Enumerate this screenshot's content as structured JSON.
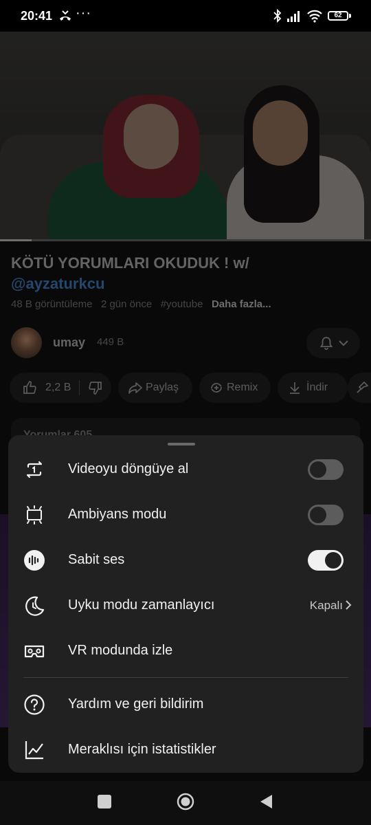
{
  "status_bar": {
    "time": "20:41",
    "battery": "62"
  },
  "video": {
    "progress": 0.085
  },
  "title": {
    "text": "KÖTÜ YORUMLARI OKUDUK ! w/",
    "mention": "@ayzaturkcu"
  },
  "meta": {
    "views": "48 B görüntüleme",
    "age": "2 gün önce",
    "hashtag": "#youtube",
    "more": "Daha fazla..."
  },
  "channel": {
    "name": "umay",
    "subscribers": "449 B"
  },
  "actions": {
    "likes": "2,2 B",
    "share": "Paylaş",
    "remix": "Remix",
    "download": "İndir"
  },
  "comments": {
    "label": "Yorumlar 605"
  },
  "sheet": {
    "items": [
      {
        "label": "Videoyu döngüye al",
        "icon": "loop-icon",
        "toggle": false
      },
      {
        "label": "Ambiyans modu",
        "icon": "ambient-mode-icon",
        "toggle": false
      },
      {
        "label": "Sabit ses",
        "icon": "stable-volume-icon",
        "toggle": true
      },
      {
        "label": "Uyku modu zamanlayıcı",
        "icon": "sleep-timer-icon",
        "value": "Kapalı"
      },
      {
        "label": "VR modunda izle",
        "icon": "vr-headset-icon"
      },
      {
        "label": "Yardım ve geri bildirim",
        "icon": "help-icon"
      },
      {
        "label": "Meraklısı için istatistikler",
        "icon": "stats-icon"
      }
    ]
  },
  "colors": {
    "sheet_bg": "#212121",
    "toggle_on": "#f1f1f1",
    "toggle_off": "#5c5c5c",
    "mention": "#3b6da8"
  }
}
